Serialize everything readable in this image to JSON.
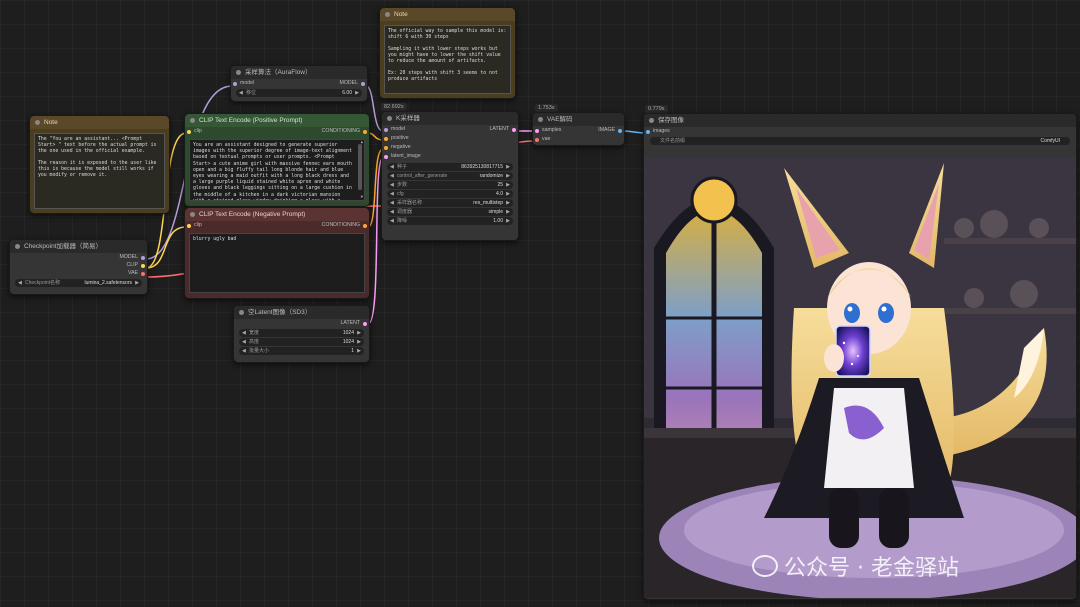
{
  "colors": {
    "model": "#b39ddb",
    "clip": "#ffd54f",
    "vae": "#ff6e6e",
    "conditioning": "#ffa931",
    "latent": "#ff9cf9",
    "image": "#64b5f6"
  },
  "note1": {
    "title": "Note",
    "text": "The \"You are an assistant... <Prompt Start> \" text before the actual prompt is the one used in the official example.\n\nThe reason it is exposed to the user like this is because the model still works if you modify or remove it."
  },
  "note2": {
    "title": "Note",
    "text": "The official way to sample this model is: shift 6 with 30 steps\n\nSampling it with lower steps works but you might have to lower the shift value to reduce the amount of artifacts.\n\nEx: 20 steps with shift 3 seems to not produce artifacts"
  },
  "checkpoint": {
    "title": "Checkpoint加载器（简易）",
    "outputs": [
      "MODEL",
      "CLIP",
      "VAE"
    ],
    "widget_label": "Checkpoint名称",
    "widget_value": "lumina_2.safetensors"
  },
  "sampling": {
    "title": "采样算法（AuraFlow）",
    "input": "model",
    "output": "MODEL",
    "widget_label": "移位",
    "widget_value": "6.00"
  },
  "clip_pos": {
    "title": "CLIP Text Encode (Positive Prompt)",
    "input": "clip",
    "output": "CONDITIONING",
    "text": "You are an assistant designed to generate superior images with the superior degree of image-text alignment based on textual prompts or user prompts. <Prompt Start> a cute anime girl with massive fennec ears mouth open and a big fluffy tail long blonde hair and blue eyes wearing a maid outfit with a long black dress and a large purple liquid stained white apron and white gloves and black leggings sitting on a large cushion in the middle of a kitchen in a dark victorian mansion with a stained glass window drinking a glass with a galaxy inside"
  },
  "clip_neg": {
    "title": "CLIP Text Encode (Negative Prompt)",
    "input": "clip",
    "output": "CONDITIONING",
    "text": "blurry ugly bad"
  },
  "latent": {
    "title": "空Latent图像（SD3）",
    "output": "LATENT",
    "widgets": [
      {
        "label": "宽度",
        "value": "1024"
      },
      {
        "label": "高度",
        "value": "1024"
      },
      {
        "label": "批量大小",
        "value": "1"
      }
    ]
  },
  "ksampler": {
    "title": "K采样器",
    "timing": "82.692s",
    "inputs": [
      "model",
      "positive",
      "negative",
      "latent_image"
    ],
    "output": "LATENT",
    "widgets": [
      {
        "label": "种子",
        "value": "863925130817715"
      },
      {
        "label": "control_after_generate",
        "value": "randomize"
      },
      {
        "label": "步数",
        "value": "25"
      },
      {
        "label": "cfg",
        "value": "4.0"
      },
      {
        "label": "采样器名称",
        "value": "res_multistep"
      },
      {
        "label": "调度器",
        "value": "simple"
      },
      {
        "label": "降噪",
        "value": "1.00"
      }
    ]
  },
  "vae_decode": {
    "title": "VAE解码",
    "timing": "1.753s",
    "inputs": [
      "samples",
      "vae"
    ],
    "output": "IMAGE"
  },
  "save": {
    "title": "保存图像",
    "timing": "0.779s",
    "input": "images",
    "widget_label": "文件名前缀",
    "widget_value": "ComfyUI"
  },
  "watermark": {
    "text": "公众号 · 老金驿站"
  }
}
